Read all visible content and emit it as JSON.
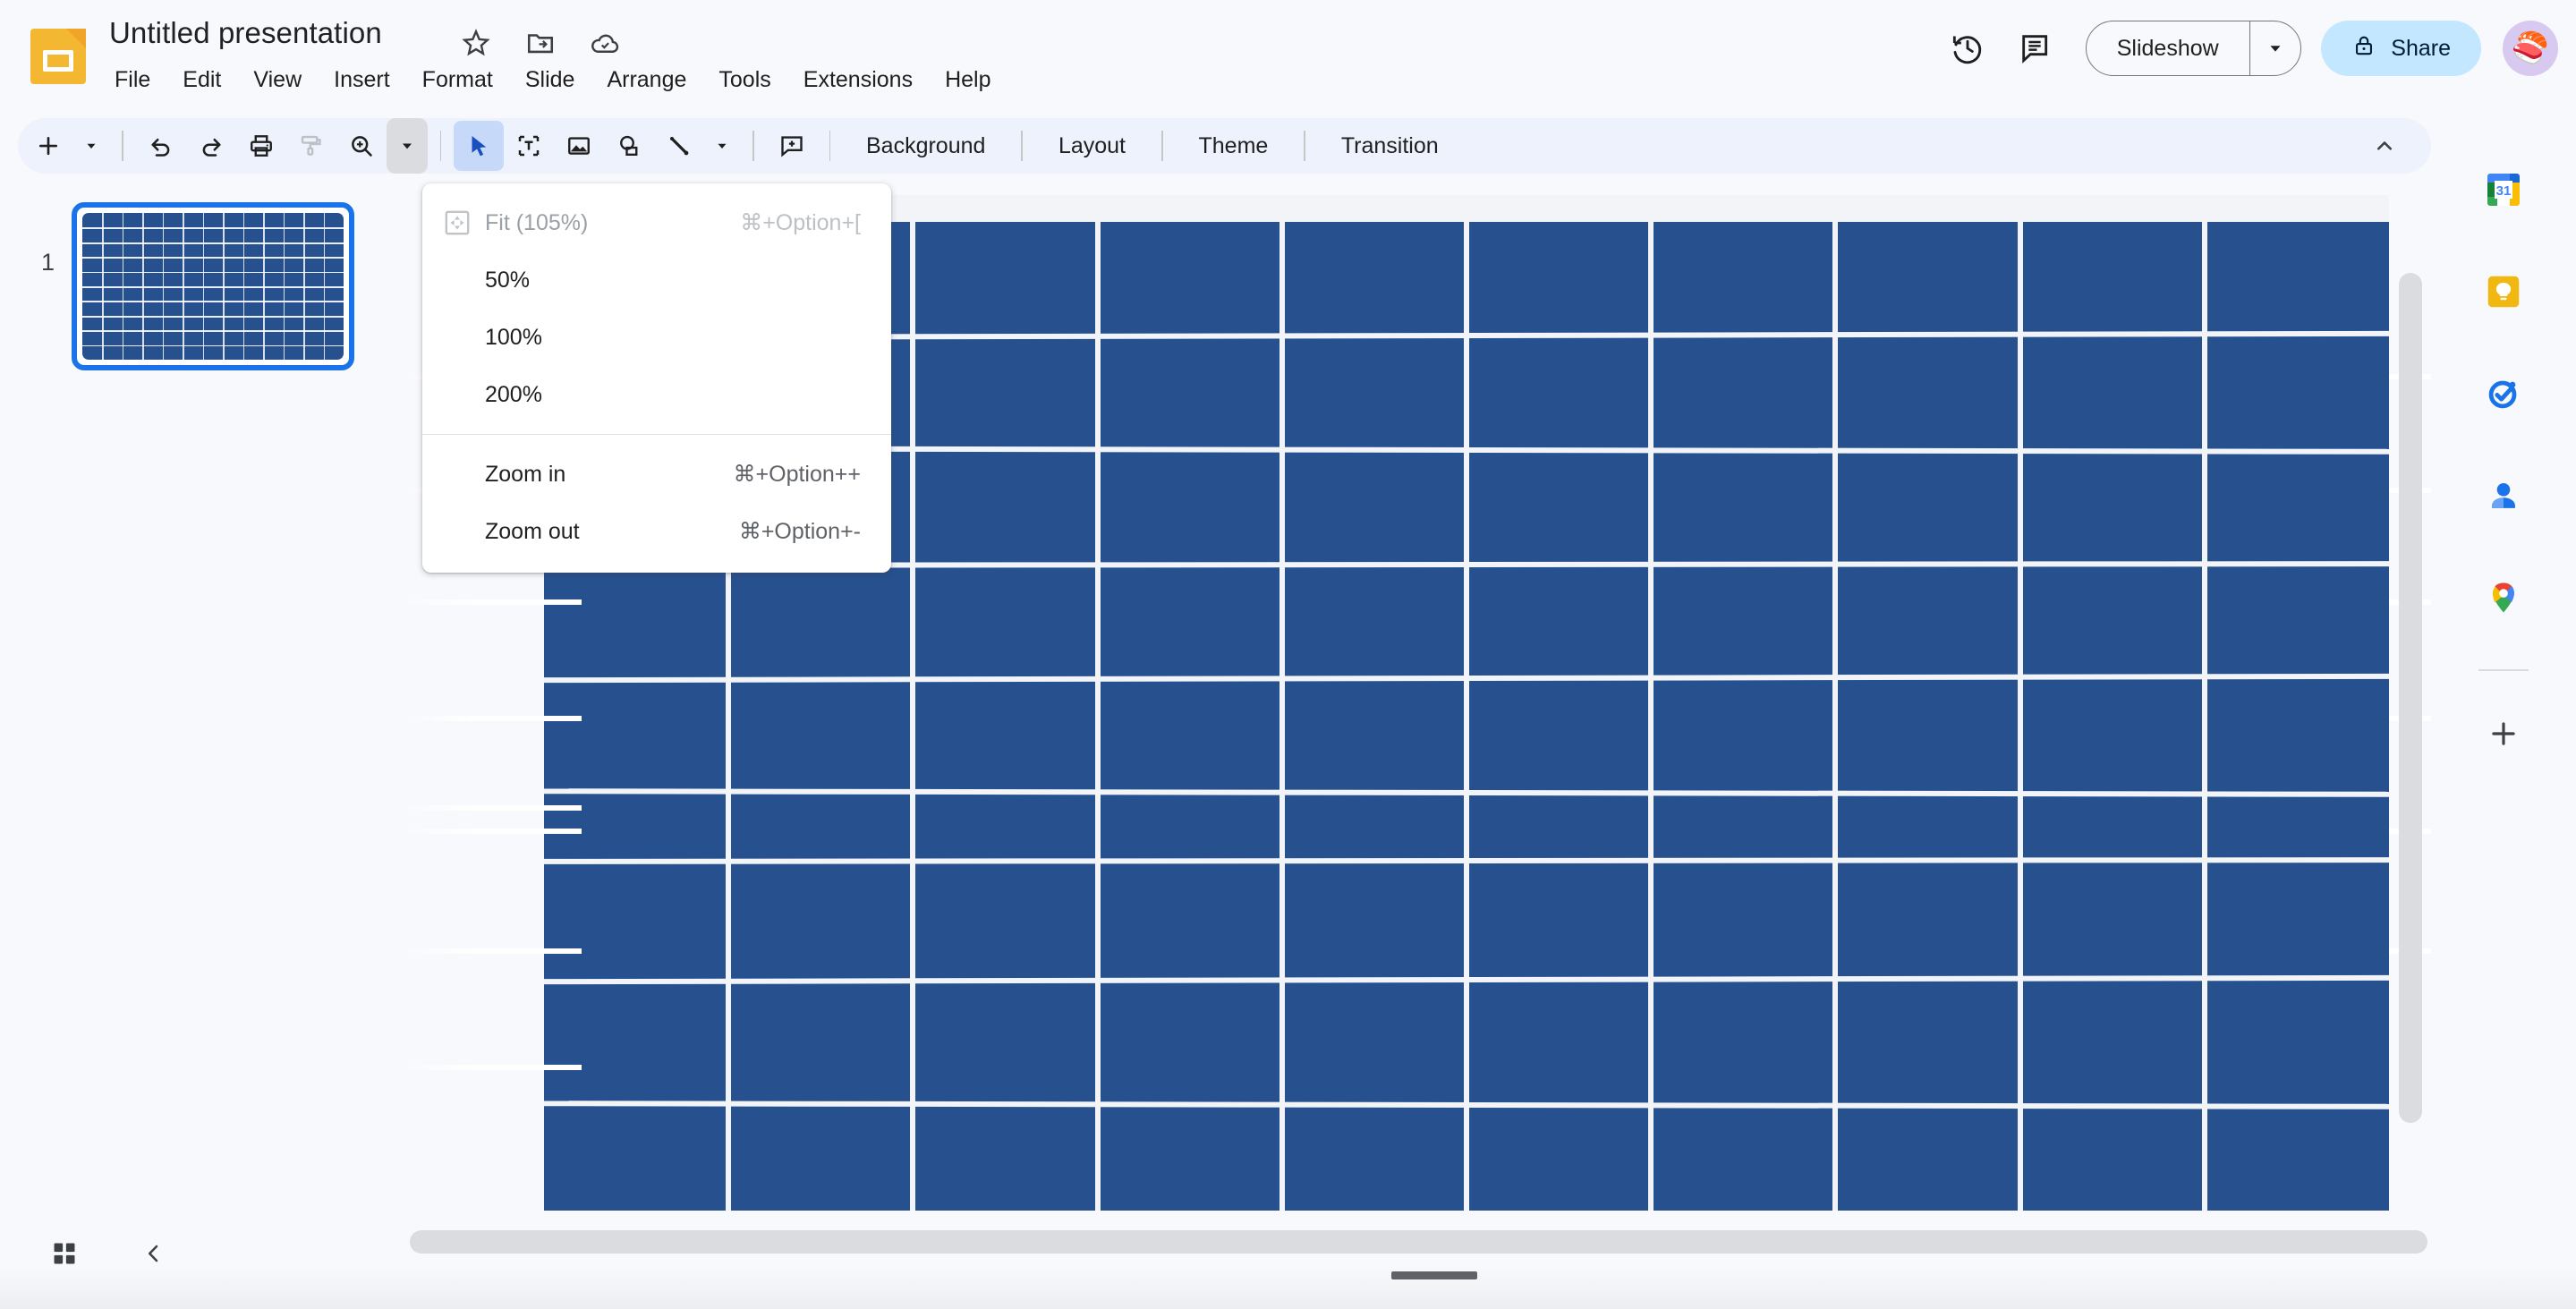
{
  "app": {
    "icon_name": "slides-app-icon",
    "brand_color": "#f4b731",
    "title": "Untitled presentation"
  },
  "title_actions": [
    {
      "name": "star-icon",
      "label": "Star"
    },
    {
      "name": "move-to-folder-icon",
      "label": "Move"
    },
    {
      "name": "cloud-saved-icon",
      "label": "Saved to Drive"
    }
  ],
  "menubar": {
    "items": [
      {
        "label": "File"
      },
      {
        "label": "Edit"
      },
      {
        "label": "View"
      },
      {
        "label": "Insert"
      },
      {
        "label": "Format"
      },
      {
        "label": "Slide"
      },
      {
        "label": "Arrange"
      },
      {
        "label": "Tools"
      },
      {
        "label": "Extensions"
      },
      {
        "label": "Help"
      }
    ]
  },
  "topright": {
    "history_icon": "version-history-icon",
    "comment_icon": "comment-history-icon",
    "slideshow_label": "Slideshow",
    "slideshow_caret": "chevron-down-icon",
    "share_label": "Share",
    "share_lock_icon": "lock-icon",
    "share_bg": "#c2e7ff",
    "avatar_glyph": "🍣"
  },
  "toolbar": {
    "buttons": [
      {
        "name": "new-slide-button",
        "icon": "plus-icon"
      },
      {
        "name": "new-slide-caret",
        "icon": "chevron-down-icon"
      },
      {
        "name": "undo-button",
        "icon": "undo-icon"
      },
      {
        "name": "redo-button",
        "icon": "redo-icon"
      },
      {
        "name": "print-button",
        "icon": "printer-icon"
      },
      {
        "name": "paint-format-button",
        "icon": "paint-roller-icon"
      },
      {
        "name": "zoom-button",
        "icon": "zoom-in-magnifier-icon"
      },
      {
        "name": "zoom-dropdown-caret",
        "icon": "chevron-down-icon"
      },
      {
        "name": "select-tool-button",
        "icon": "cursor-arrow-icon"
      },
      {
        "name": "text-box-button",
        "icon": "text-box-icon"
      },
      {
        "name": "insert-image-button",
        "icon": "image-icon"
      },
      {
        "name": "shape-button",
        "icon": "shape-icon"
      },
      {
        "name": "line-button",
        "icon": "line-icon"
      },
      {
        "name": "line-caret",
        "icon": "chevron-down-icon"
      },
      {
        "name": "add-comment-button",
        "icon": "add-comment-icon"
      }
    ],
    "text_buttons": [
      {
        "label": "Background"
      },
      {
        "label": "Layout"
      },
      {
        "label": "Theme"
      },
      {
        "label": "Transition"
      }
    ],
    "collapse_icon": "chevron-up-icon",
    "active_tool": "select-tool-button"
  },
  "zoom_menu": {
    "open": true,
    "items": [
      {
        "label": "Fit (105%)",
        "accel": "⌘+Option+[",
        "disabled": true,
        "icon": "fit-to-screen-icon",
        "indent": false
      },
      {
        "label": "50%",
        "accel": "",
        "disabled": false,
        "icon": "",
        "indent": true
      },
      {
        "label": "100%",
        "accel": "",
        "disabled": false,
        "icon": "",
        "indent": true
      },
      {
        "label": "200%",
        "accel": "",
        "disabled": false,
        "icon": "",
        "indent": true
      }
    ],
    "items_after_separator": [
      {
        "label": "Zoom in",
        "accel": "⌘+Option++",
        "disabled": false,
        "icon": "",
        "indent": true
      },
      {
        "label": "Zoom out",
        "accel": "⌘+Option+-",
        "disabled": false,
        "icon": "",
        "indent": true
      }
    ]
  },
  "filmstrip": {
    "slides": [
      {
        "number": "1",
        "selected": true,
        "content_name": "solar-panel-image"
      }
    ]
  },
  "canvas": {
    "slide_content": "solar-panel-image",
    "panel_color": "#27508f",
    "grout_color": "#f2f4f8",
    "columns": 10,
    "rows": 9,
    "vertical_scrollbar": "canvas-vertical-scrollbar",
    "horizontal_scrollbar": "canvas-horizontal-scrollbar"
  },
  "rightrail": {
    "items": [
      {
        "name": "google-calendar-icon",
        "label": "Calendar"
      },
      {
        "name": "google-keep-icon",
        "label": "Keep"
      },
      {
        "name": "google-tasks-icon",
        "label": "Tasks"
      },
      {
        "name": "google-contacts-icon",
        "label": "Contacts"
      },
      {
        "name": "google-maps-icon",
        "label": "Maps"
      }
    ],
    "add_label": "Get add-ons",
    "add_icon": "plus-icon"
  },
  "bottombar": {
    "grid_view_icon": "grid-view-icon",
    "collapse_filmstrip_icon": "chevron-left-icon",
    "notes_handle": "speaker-notes-drag-handle"
  }
}
